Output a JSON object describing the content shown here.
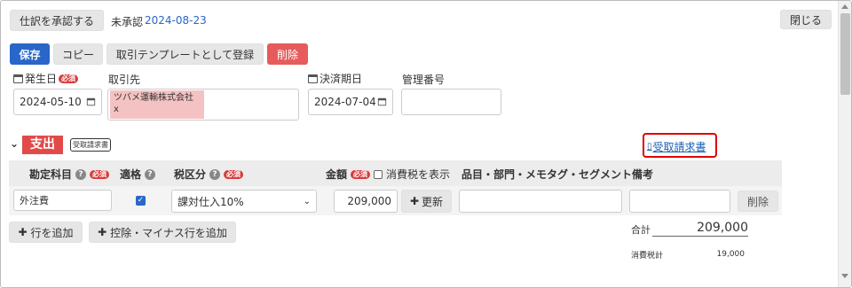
{
  "header": {
    "approve_button": "仕訳を承認する",
    "status": "未承認",
    "date": "2024-08-23",
    "close_button": "閉じる"
  },
  "toolbar": {
    "save": "保存",
    "copy": "コピー",
    "register_template": "取引テンプレートとして登録",
    "delete": "削除"
  },
  "fields": {
    "issue_date_label": "発生日",
    "required": "必須",
    "issue_date": "2024-05-10",
    "partner_label": "取引先",
    "partner_tag": "ツバメ運輸株式会社",
    "partner_tag_remove": "x",
    "settlement_date_label": "決済期日",
    "settlement_date": "2024-07-04",
    "management_no_label": "管理番号",
    "management_no": ""
  },
  "section": {
    "type": "支出",
    "received_invoice_badge": "受取請求書",
    "received_invoice_link": "受取請求書"
  },
  "table": {
    "headers": {
      "account": "勘定科目",
      "applicable": "適格",
      "tax_class": "税区分",
      "amount": "金額",
      "show_tax": "消費税を表示",
      "segment": "品目・部門・メモタグ・セグメント",
      "memo": "備考"
    },
    "row": {
      "account": "外注費",
      "applicable_checked": true,
      "tax_class": "課対仕入10%",
      "amount": "209,000",
      "update": "更新",
      "segment": "",
      "memo": "",
      "delete": "削除"
    }
  },
  "actions": {
    "add_row": "行を追加",
    "add_deduction_row": "控除・マイナス行を追加"
  },
  "totals": {
    "total_label": "合計",
    "total_value": "209,000",
    "tax_label": "消費税計",
    "tax_value": "19,000"
  },
  "colors": {
    "primary": "#2966c9",
    "danger": "#e65c5c",
    "section_red": "#e24a4a",
    "link": "#1a5fb4",
    "highlight_border": "#e00000",
    "partner_tag_bg": "#f4c2c2"
  }
}
